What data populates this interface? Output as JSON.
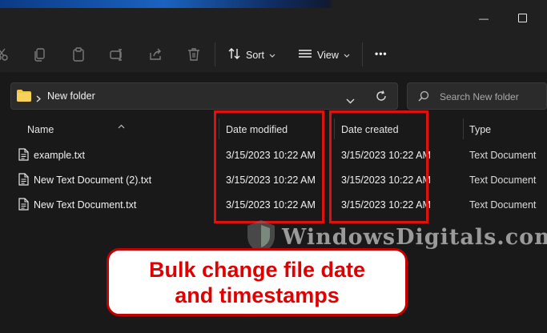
{
  "window": {
    "minimize_glyph": "—",
    "maximize_glyph": "☐"
  },
  "toolbar": {
    "sort_label": "Sort",
    "view_label": "View",
    "more_label": "•••"
  },
  "address": {
    "path": "New folder",
    "search_placeholder": "Search New folder"
  },
  "columns": {
    "name": "Name",
    "date_modified": "Date modified",
    "date_created": "Date created",
    "type": "Type"
  },
  "files": [
    {
      "name": "example.txt",
      "modified": "3/15/2023 10:22 AM",
      "created": "3/15/2023 10:22 AM",
      "type": "Text Document"
    },
    {
      "name": "New Text Document (2).txt",
      "modified": "3/15/2023 10:22 AM",
      "created": "3/15/2023 10:22 AM",
      "type": "Text Document"
    },
    {
      "name": "New Text Document.txt",
      "modified": "3/15/2023 10:22 AM",
      "created": "3/15/2023 10:22 AM",
      "type": "Text Document"
    }
  ],
  "watermark": "WindowsDigitals.com",
  "callout": {
    "line1": "Bulk change file date",
    "line2": "and timestamps"
  },
  "colors": {
    "highlight_red": "#e01010",
    "callout_red": "#e00000",
    "folder_yellow": "#f2c744"
  }
}
